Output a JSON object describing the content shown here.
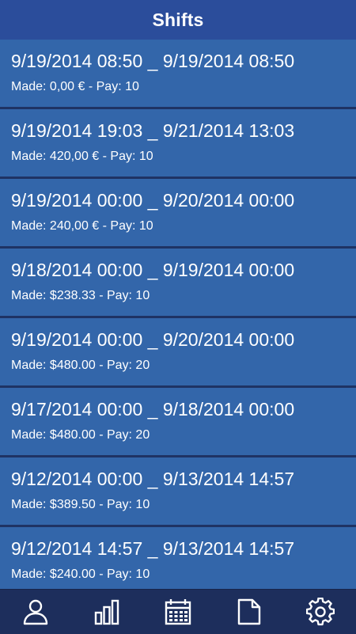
{
  "header": {
    "title": "Shifts"
  },
  "shifts": [
    {
      "range": "9/19/2014 08:50 _ 9/19/2014 08:50",
      "detail": "Made: 0,00 € - Pay: 10"
    },
    {
      "range": "9/19/2014 19:03 _ 9/21/2014 13:03",
      "detail": "Made: 420,00 € - Pay: 10"
    },
    {
      "range": "9/19/2014 00:00 _ 9/20/2014 00:00",
      "detail": "Made: 240,00 € - Pay: 10"
    },
    {
      "range": "9/18/2014 00:00 _ 9/19/2014 00:00",
      "detail": "Made: $238.33 - Pay: 10"
    },
    {
      "range": "9/19/2014 00:00 _ 9/20/2014 00:00",
      "detail": "Made: $480.00 - Pay: 20"
    },
    {
      "range": "9/17/2014 00:00 _ 9/18/2014 00:00",
      "detail": "Made: $480.00 - Pay: 20"
    },
    {
      "range": "9/12/2014 00:00 _ 9/13/2014 14:57",
      "detail": "Made: $389.50 - Pay: 10"
    },
    {
      "range": "9/12/2014 14:57 _ 9/13/2014 14:57",
      "detail": "Made: $240.00 - Pay: 10"
    }
  ],
  "bottom_nav": [
    {
      "icon": "person-icon"
    },
    {
      "icon": "bar-chart-icon"
    },
    {
      "icon": "calendar-icon"
    },
    {
      "icon": "document-icon"
    },
    {
      "icon": "gear-icon"
    }
  ],
  "colors": {
    "header_bg": "#2b4d9b",
    "item_bg": "#3366aa",
    "nav_bg": "#1d2e5c",
    "text": "#ffffff"
  }
}
